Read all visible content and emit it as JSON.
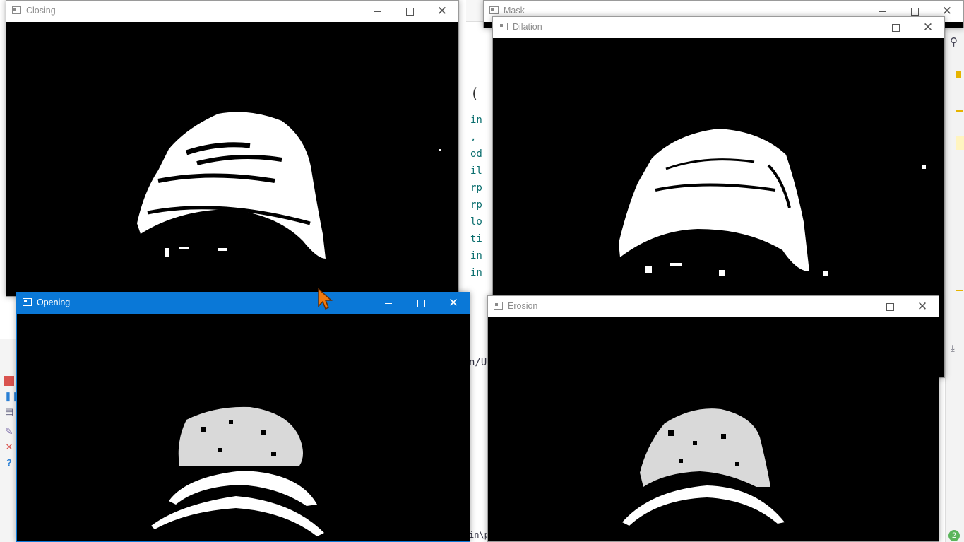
{
  "windows": {
    "mask": {
      "title": "Mask"
    },
    "closing": {
      "title": "Closing"
    },
    "dilation": {
      "title": "Dilation"
    },
    "opening": {
      "title": "Opening"
    },
    "erosion": {
      "title": "Erosion"
    }
  },
  "ide": {
    "code_fragments": [
      "(",
      "in",
      ",",
      "od",
      "il",
      "rp",
      "rp",
      "lo",
      "ti",
      "in",
      "in"
    ],
    "bottom_path_1": "n/U",
    "bottom_path_2": "in\\p",
    "status_count": "2"
  },
  "colors": {
    "active_title": "#0a78d7",
    "mask_foreground": "#ffffff",
    "mask_background": "#000000"
  },
  "icons": [
    "window-icon",
    "minimize-icon",
    "maximize-icon",
    "close-icon",
    "search-icon",
    "stop-icon",
    "pause-icon",
    "cursor-arrow-icon"
  ]
}
